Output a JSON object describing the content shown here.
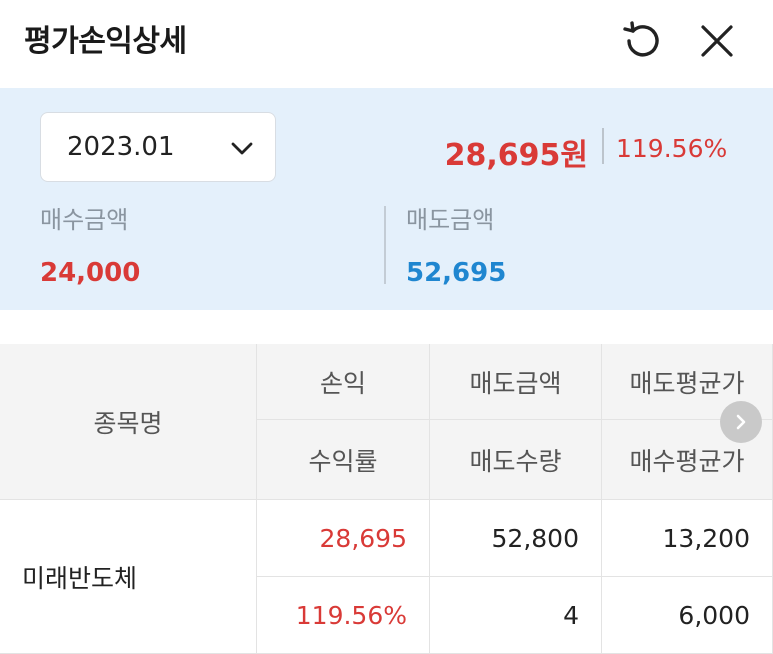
{
  "header": {
    "title": "평가손익상세",
    "refresh_icon": "refresh-icon",
    "close_icon": "close-icon"
  },
  "summary": {
    "period": "2023.01",
    "profit_amount": "28,695원",
    "profit_rate": "119.56%",
    "buy_label": "매수금액",
    "buy_value": "24,000",
    "sell_label": "매도금액",
    "sell_value": "52,695"
  },
  "table": {
    "headers": {
      "name": "종목명",
      "profit": "손익",
      "sell_amount": "매도금액",
      "sell_avg_price": "매도평균가",
      "return_rate": "수익률",
      "sell_qty": "매도수량",
      "buy_avg_price": "매수평균가"
    },
    "rows": [
      {
        "name": "미래반도체",
        "profit": "28,695",
        "sell_amount": "52,800",
        "sell_avg_price": "13,200",
        "return_rate": "119.56%",
        "sell_qty": "4",
        "buy_avg_price": "6,000"
      }
    ]
  },
  "colors": {
    "positive": "#d93a37",
    "sell_blue": "#1f86d0",
    "summary_bg": "#e4f0fb"
  }
}
